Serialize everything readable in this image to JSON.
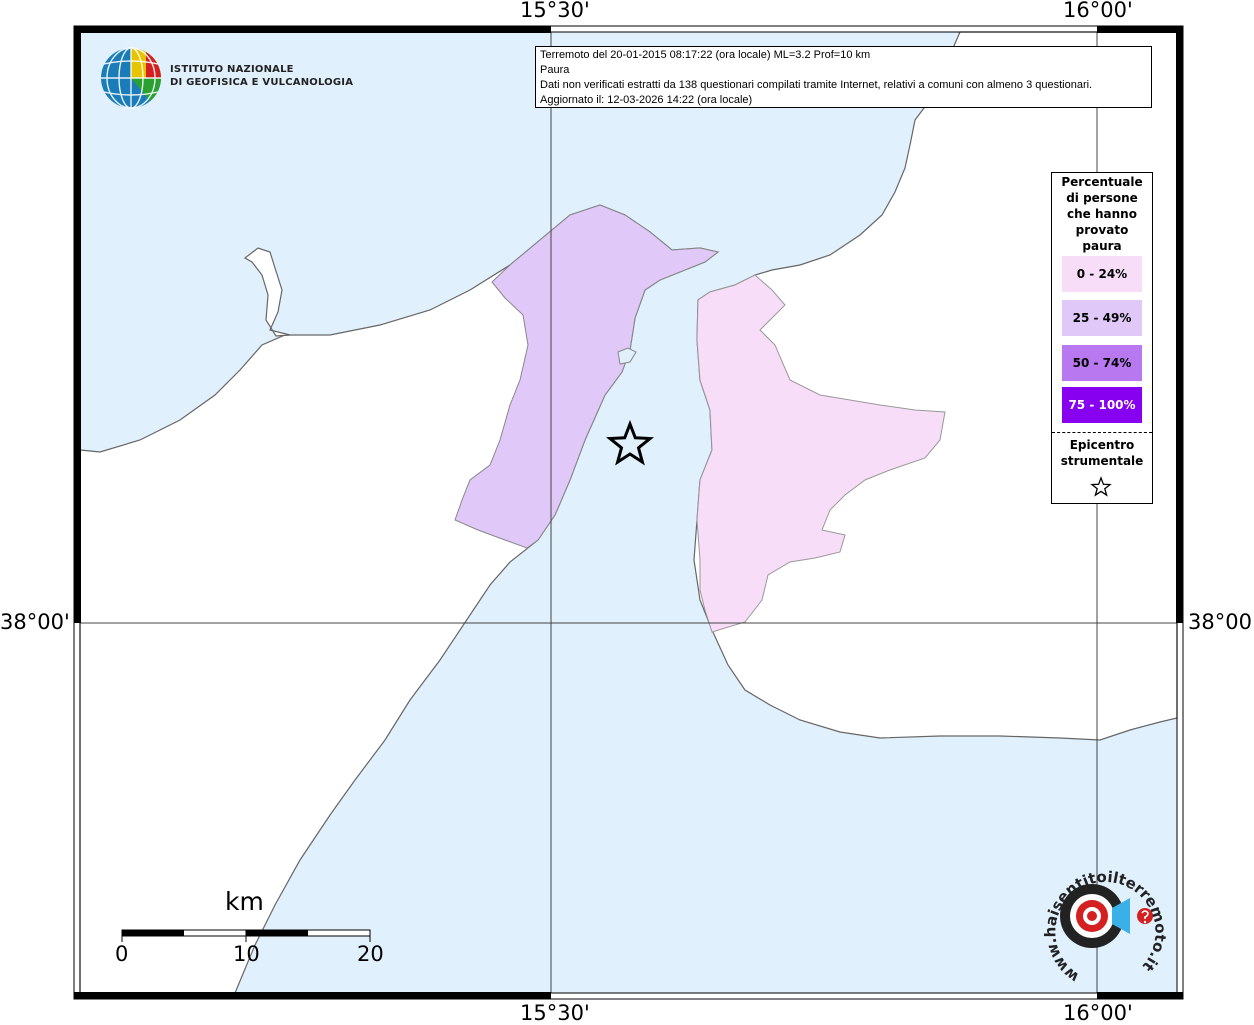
{
  "graticule": {
    "lon_left": "15°30'",
    "lon_right": "16°00'",
    "lat": "38°00'"
  },
  "info": {
    "line1": "Terremoto del 20-01-2015 08:17:22 (ora locale) ML=3.2 Prof=10 km",
    "line2": "Paura",
    "line3": "Dati non verificati estratti da 138 questionari compilati tramite Internet, relativi a comuni con almeno 3 questionari.",
    "line4": "Aggiornato il: 12-03-2026 14:22 (ora locale)"
  },
  "logo": {
    "line1": "ISTITUTO NAZIONALE",
    "line2": "DI GEOFISICA E VULCANOLOGIA"
  },
  "legend": {
    "title1": "Percentuale",
    "title2": "di persone",
    "title3": "che hanno",
    "title4": "provato",
    "title5": "paura",
    "classes": [
      {
        "label": "0 - 24%",
        "color": "#f8ddf8"
      },
      {
        "label": "25 - 49%",
        "color": "#e0c8f8"
      },
      {
        "label": "50 - 74%",
        "color": "#b878f0"
      },
      {
        "label": "75 - 100%",
        "color": "#8800f0"
      }
    ],
    "epicenter1": "Epicentro",
    "epicenter2": "strumentale"
  },
  "scale": {
    "unit": "km",
    "ticks": [
      "0",
      "10",
      "20"
    ]
  },
  "colors": {
    "sea": "#e0f0fc",
    "land": "#ffffff",
    "coast": "#666666"
  },
  "watermark": {
    "text": "www.haisentitoilterremoto.it"
  }
}
